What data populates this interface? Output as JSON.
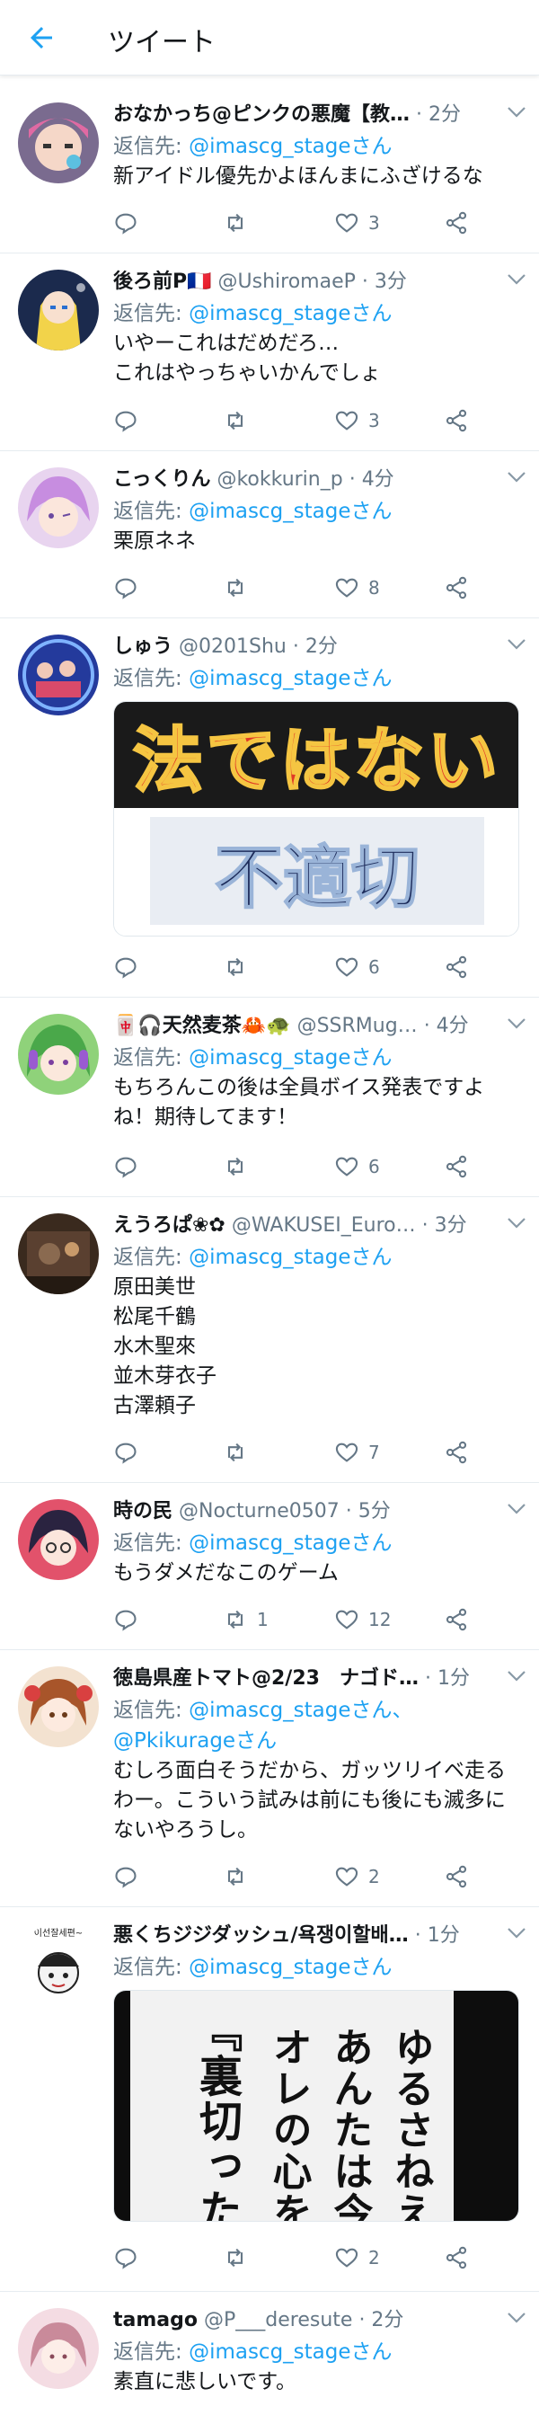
{
  "header": {
    "title": "ツイート"
  },
  "reply_prefix": "返信先: ",
  "tweets": [
    {
      "name": "おなかっち@ピンクの悪魔【教…",
      "handle": "",
      "time": "· 2分",
      "reply_to": "@imascg_stageさん",
      "text": "新アイドル優先かよほんまにふざけるな",
      "counts": {
        "reply": "",
        "retweet": "",
        "like": "3"
      },
      "avatar": {
        "bg": "#7a6b8f"
      }
    },
    {
      "name": "後ろ前P🇫🇷",
      "handle": "@UshiromaeP",
      "time": "· 3分",
      "reply_to": "@imascg_stageさん",
      "text": "いやーこれはだめだろ…\nこれはやっちゃいかんでしょ",
      "counts": {
        "reply": "",
        "retweet": "",
        "like": "3"
      },
      "avatar": {
        "bg": "#1b2a4d"
      }
    },
    {
      "name": "こっくりん",
      "handle": "@kokkurin_p",
      "time": "· 4分",
      "reply_to": "@imascg_stageさん",
      "text": "栗原ネネ",
      "counts": {
        "reply": "",
        "retweet": "",
        "like": "8"
      },
      "avatar": {
        "bg": "#e8d4ef"
      }
    },
    {
      "name": "しゅう",
      "handle": "@0201Shu",
      "time": "· 2分",
      "reply_to": "@imascg_stageさん",
      "text": "",
      "media": {
        "line1": "法ではない",
        "line2": "不適切"
      },
      "counts": {
        "reply": "",
        "retweet": "",
        "like": "6"
      },
      "avatar": {
        "bg": "#243a9c"
      }
    },
    {
      "name": "🀄🎧天然麦茶🦀🐢",
      "handle": "@SSRMug…",
      "time": "· 4分",
      "reply_to": "@imascg_stageさん",
      "text": "もちろんこの後は全員ボイス発表ですよね！期待してます！",
      "counts": {
        "reply": "",
        "retweet": "",
        "like": "6"
      },
      "avatar": {
        "bg": "#8fd27a"
      }
    },
    {
      "name": "えうろぱ❀✿",
      "handle": "@WAKUSEI_Euro…",
      "time": "· 3分",
      "reply_to": "@imascg_stageさん",
      "text": "原田美世\n松尾千鶴\n水木聖來\n並木芽衣子\n古澤頼子",
      "counts": {
        "reply": "",
        "retweet": "",
        "like": "7"
      },
      "avatar": {
        "bg": "#3a2a1e"
      }
    },
    {
      "name": "時の民",
      "handle": "@Nocturne0507",
      "time": "· 5分",
      "reply_to": "@imascg_stageさん",
      "text": "もうダメだなこのゲーム",
      "counts": {
        "reply": "",
        "retweet": "1",
        "like": "12"
      },
      "avatar": {
        "bg": "#e2526b"
      }
    },
    {
      "name": "徳島県産トマト@2/23　ナゴド…",
      "handle": "",
      "time": "· 1分",
      "reply_to": "@imascg_stageさん、\n@Pkikurageさん",
      "text": "むしろ面白そうだから、ガッツリイベ走るわー。こういう試みは前にも後にも滅多にないやろうし。",
      "counts": {
        "reply": "",
        "retweet": "",
        "like": "2"
      },
      "avatar": {
        "bg": "#f3e2d0"
      }
    },
    {
      "name": "悪くちジジダッシュ/욕쟁이할배…",
      "handle": "",
      "time": "· 1分",
      "reply_to": "@imascg_stageさん",
      "text": "",
      "media": {
        "line1": "ゆるさねえ",
        "line2": "あんたは今",
        "line3": "オレの心を",
        "line4": "『裏切ったん"
      },
      "counts": {
        "reply": "",
        "retweet": "",
        "like": "2"
      },
      "avatar": {
        "bg": "#ffffff",
        "caption": "이선잘세편~"
      }
    },
    {
      "name": "tamago",
      "handle": "@P___deresute",
      "time": "· 2分",
      "reply_to": "@imascg_stageさん",
      "text": "素直に悲しいです。",
      "counts": {
        "reply": "",
        "retweet": "",
        "like": ""
      },
      "avatar": {
        "bg": "#f4dce3"
      }
    }
  ],
  "colors": {
    "link": "#1da1f2",
    "muted": "#657786",
    "divider": "#e6ecf0"
  },
  "icons": [
    "back-arrow-icon",
    "caret-down-icon",
    "reply-icon",
    "retweet-icon",
    "like-icon",
    "share-icon"
  ]
}
